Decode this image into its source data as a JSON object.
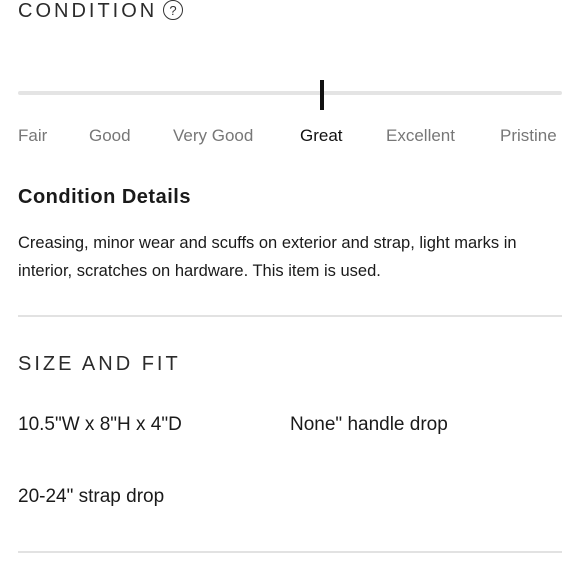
{
  "condition": {
    "heading": "CONDITION",
    "help_icon": "question-circle-icon",
    "help_glyph": "?",
    "scale": [
      "Fair",
      "Good",
      "Very Good",
      "Great",
      "Excellent",
      "Pristine"
    ],
    "selected": "Great",
    "selected_index": 3
  },
  "condition_details": {
    "title": "Condition Details",
    "text": "Creasing, minor wear and scuffs on exterior and strap, light marks in interior, scratches on hardware. This item is used."
  },
  "size_and_fit": {
    "heading": "SIZE AND FIT",
    "dimensions": "10.5\"W x 8\"H x 4\"D",
    "handle_drop": "None\" handle drop",
    "strap_drop": "20-24\" strap drop"
  },
  "colors": {
    "track": "#e4e4e4",
    "thumb": "#111111",
    "unselected_label": "#777777",
    "selected_label": "#111111",
    "divider": "#e2e2e2"
  }
}
